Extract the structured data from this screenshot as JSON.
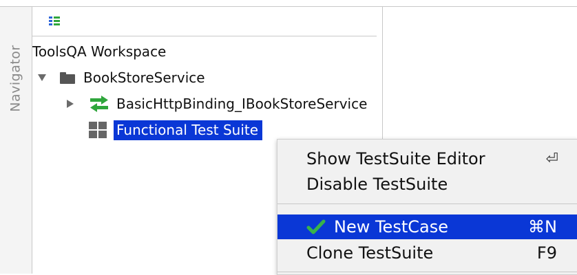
{
  "navigator": {
    "tab_label": "Navigator"
  },
  "tree": {
    "workspace_label": "ToolsQA Workspace",
    "project_label": "BookStoreService",
    "interface_label": "BasicHttpBinding_IBookStoreService",
    "testsuite_label": "Functional Test Suite"
  },
  "context_menu": {
    "show_editor_label": "Show TestSuite Editor",
    "show_editor_shortcut": "⏎",
    "disable_label": "Disable TestSuite",
    "new_testcase_label": "New TestCase",
    "new_testcase_shortcut": "⌘N",
    "clone_label": "Clone TestSuite",
    "clone_shortcut": "F9"
  },
  "colors": {
    "selection": "#0a37d6",
    "binding_icon_green": "#2fa63c",
    "check_green": "#38b24a"
  },
  "icons": {
    "toolbar": "list-view-icon",
    "expanded": "triangle-down-icon",
    "collapsed": "triangle-right-icon",
    "project": "folder-icon",
    "interface": "swap-arrows-icon",
    "testsuite": "grid-icon",
    "checked": "checkmark-icon",
    "return_key": "return-key-icon"
  }
}
